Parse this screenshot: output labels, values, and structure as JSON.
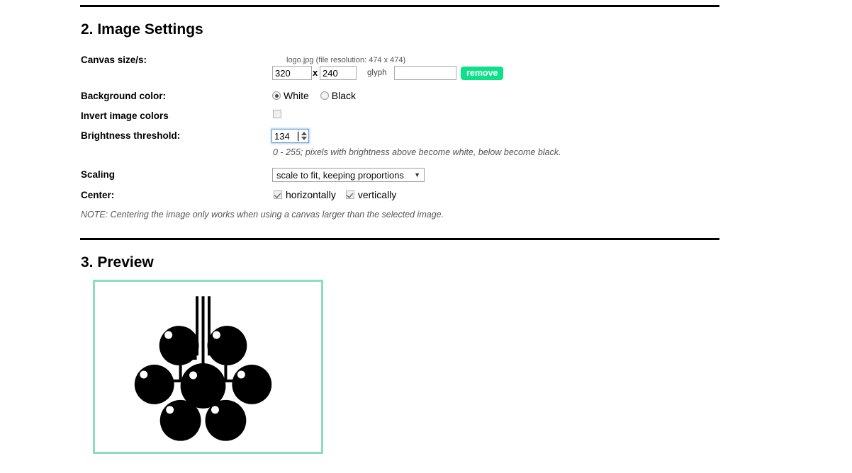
{
  "sections": {
    "settings": {
      "heading": "2. Image Settings"
    },
    "preview": {
      "heading": "3. Preview"
    }
  },
  "labels": {
    "canvas_size": "Canvas size/s:",
    "background_color": "Background color:",
    "invert_image_colors": "Invert image colors",
    "brightness_threshold": "Brightness threshold:",
    "scaling": "Scaling",
    "center": "Center:"
  },
  "canvas": {
    "file_name": "logo.jpg",
    "file_resolution": "(file resolution: 474 x 474)",
    "width_value": "320",
    "separator": "x",
    "height_value": "240",
    "glyph_label": "glyph",
    "glyph_value": "",
    "glyph_placeholder": "",
    "remove_label": "remove"
  },
  "background_color": {
    "options": [
      {
        "label": "White",
        "selected": true
      },
      {
        "label": "Black",
        "selected": false
      }
    ]
  },
  "invert": {
    "checked": false
  },
  "brightness": {
    "value": "134",
    "note": "0 - 255; pixels with brightness above become white, below become black."
  },
  "scaling": {
    "selected_option": "scale to fit, keeping proportions",
    "caret": "▼"
  },
  "center": {
    "horizontal_label": "horizontally",
    "horizontal_checked": true,
    "vertical_label": "vertically",
    "vertical_checked": true,
    "note": "NOTE: Centering the image only works when using a canvas larger than the selected image."
  },
  "preview_image": {
    "description": "black and white thresholded logo: cluster of seven berries with stems",
    "border_color": "#8ddcc2",
    "ink_color": "#000000",
    "background_color": "#ffffff"
  },
  "colors": {
    "remove_button": "#0ce08b",
    "rule": "#000000",
    "note_text": "#555555",
    "focus_ring": "#6a9fd8"
  }
}
